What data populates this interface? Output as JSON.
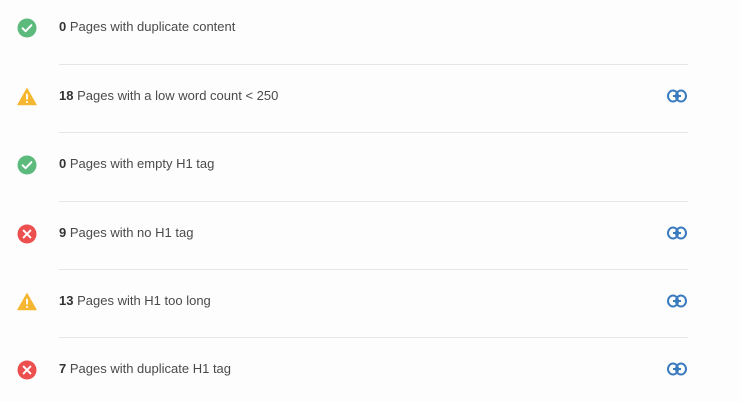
{
  "colors": {
    "success": "#5cba7d",
    "warning": "#f5b731",
    "error": "#ed4e4e",
    "link": "#3a7bbf"
  },
  "checks": [
    {
      "status": "success",
      "icon": "check-circle-icon",
      "count": "0",
      "text": "Pages with duplicate content",
      "has_link": false
    },
    {
      "status": "warning",
      "icon": "warning-triangle-icon",
      "count": "18",
      "text": "Pages with a low word count < 250",
      "has_link": true
    },
    {
      "status": "success",
      "icon": "check-circle-icon",
      "count": "0",
      "text": "Pages with empty H1 tag",
      "has_link": false
    },
    {
      "status": "error",
      "icon": "error-x-circle-icon",
      "count": "9",
      "text": "Pages with no H1 tag",
      "has_link": true
    },
    {
      "status": "warning",
      "icon": "warning-triangle-icon",
      "count": "13",
      "text": "Pages with H1 too long",
      "has_link": true
    },
    {
      "status": "error",
      "icon": "error-x-circle-icon",
      "count": "7",
      "text": "Pages with duplicate H1 tag",
      "has_link": true
    }
  ]
}
